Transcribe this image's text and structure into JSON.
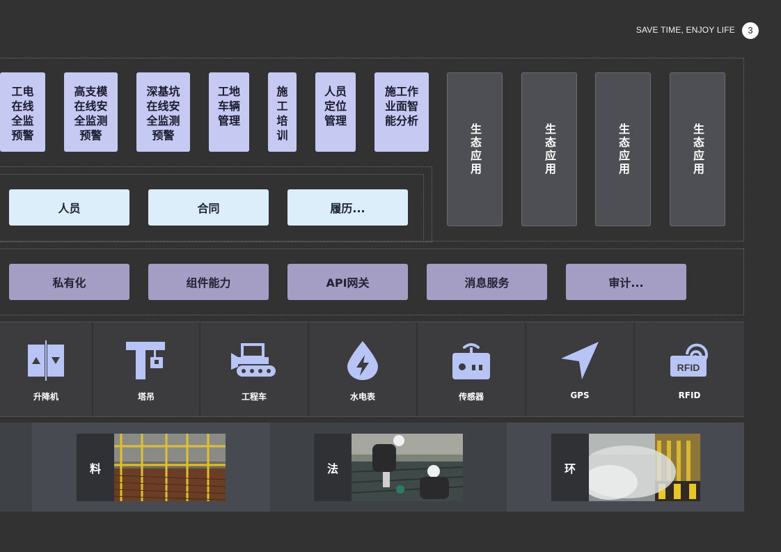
{
  "header": {
    "tagline": "SAVE TIME, ENJOY LIFE",
    "page_number": "3"
  },
  "modules": [
    {
      "label": "工电\n在线\n全监\n预警"
    },
    {
      "label": "高支模\n在线安\n全监测\n预警"
    },
    {
      "label": "深基坑\n在线安\n全监测\n预警"
    },
    {
      "label": "工地\n车辆\n管理"
    },
    {
      "label": "施\n工\n培\n训"
    },
    {
      "label": "人员\n定位\n管理"
    },
    {
      "label": "施工作\n业面智\n能分析"
    }
  ],
  "ecosystem": [
    {
      "label": "生态应用"
    },
    {
      "label": "生态应用"
    },
    {
      "label": "生态应用"
    },
    {
      "label": "生态应用"
    }
  ],
  "data_cards": [
    {
      "label": "人员"
    },
    {
      "label": "合同"
    },
    {
      "label": "履历..."
    }
  ],
  "services": [
    {
      "label": "私有化"
    },
    {
      "label": "组件能力"
    },
    {
      "label": "API网关"
    },
    {
      "label": "消息服务"
    },
    {
      "label": "审计..."
    }
  ],
  "devices": [
    {
      "label": "升降机",
      "icon": "elevator-icon"
    },
    {
      "label": "塔吊",
      "icon": "tower-crane-icon"
    },
    {
      "label": "工程车",
      "icon": "bulldozer-icon"
    },
    {
      "label": "水电表",
      "icon": "water-drop-bolt-icon"
    },
    {
      "label": "传感器",
      "icon": "sensor-icon"
    },
    {
      "label": "GPS",
      "icon": "navigation-arrow-icon"
    },
    {
      "label": "RFID",
      "icon": "rfid-icon",
      "icon_text": "RFID"
    }
  ],
  "bottom": [
    {
      "label": "料"
    },
    {
      "label": "法"
    },
    {
      "label": "环"
    }
  ],
  "colors": {
    "background": "#323232",
    "module": "#c6c9f2",
    "data_card": "#dbeef9",
    "service": "#a49dc4",
    "icon": "#b7c4f5"
  }
}
